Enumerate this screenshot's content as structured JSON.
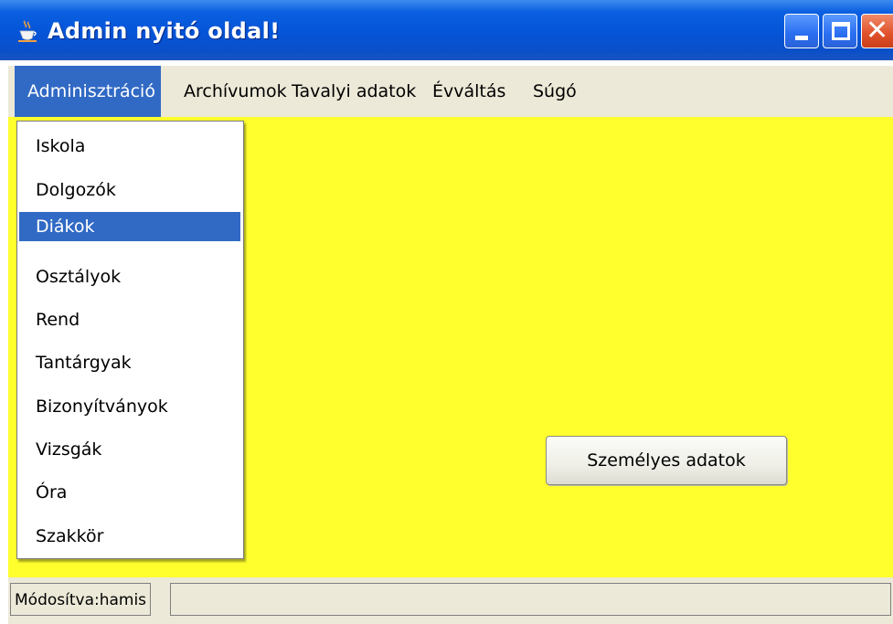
{
  "window": {
    "title": "Admin nyitó oldal!",
    "icon": "java-cup-icon",
    "controls": [
      "minimize-icon",
      "maximize-icon",
      "close-icon"
    ]
  },
  "menubar": {
    "items": [
      {
        "label": "Adminisztráció",
        "active": true
      },
      {
        "label": "Archívumok",
        "active": false
      },
      {
        "label": "Tavalyi adatok",
        "active": false
      },
      {
        "label": "Évváltás",
        "active": false
      },
      {
        "label": "Súgó",
        "active": false
      }
    ]
  },
  "dropdown": {
    "items": [
      {
        "label": "Iskola",
        "selected": false
      },
      {
        "label": "Dolgozók",
        "selected": false
      },
      {
        "label": "Diákok",
        "selected": true
      },
      {
        "label": "Osztályok",
        "selected": false
      },
      {
        "label": "Rend",
        "selected": false
      },
      {
        "label": "Tantárgyak",
        "selected": false
      },
      {
        "label": "Bizonyítványok",
        "selected": false
      },
      {
        "label": "Vizsgák",
        "selected": false
      },
      {
        "label": "Óra",
        "selected": false
      },
      {
        "label": "Szakkör",
        "selected": false
      }
    ]
  },
  "main": {
    "button_label": "Személyes adatok"
  },
  "statusbar": {
    "text": "Módosítva:hamis"
  },
  "colors": {
    "content_background": "#ffff2e",
    "selection": "#316ac5",
    "titlebar": "#0554d8"
  }
}
